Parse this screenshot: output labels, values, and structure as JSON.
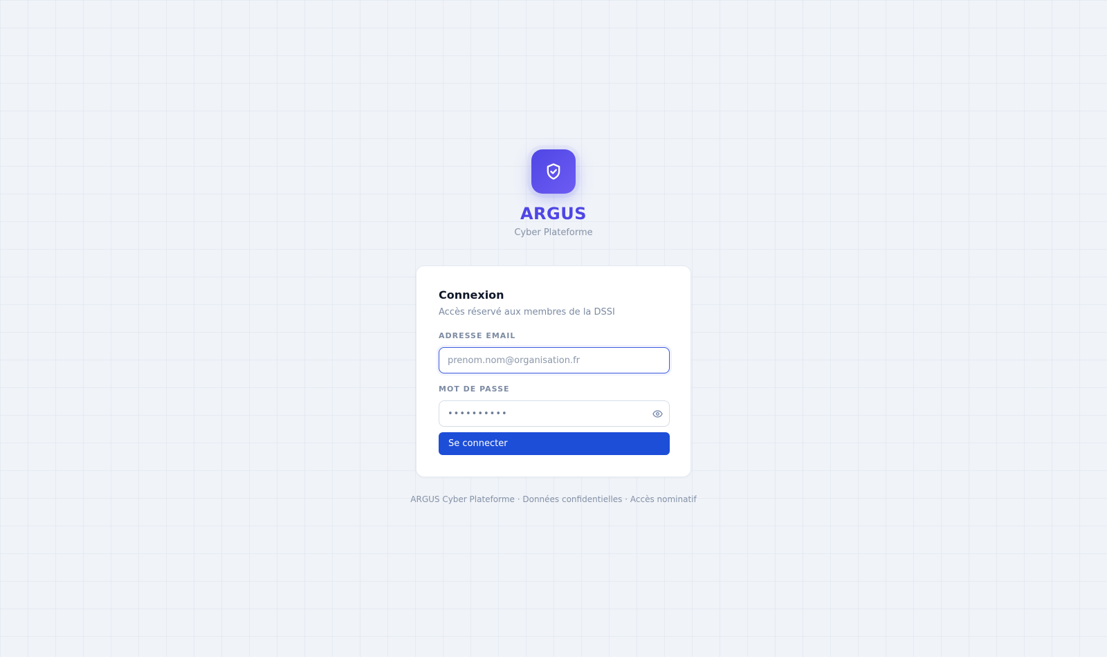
{
  "brand": {
    "name": "ARGUS",
    "tagline": "Cyber Plateforme",
    "logo_icon": "shield-check-icon",
    "accent_color": "#4f46e5"
  },
  "login": {
    "title": "Connexion",
    "subtitle": "Accès réservé aux membres de la DSSI",
    "email": {
      "label": "ADRESSE EMAIL",
      "placeholder": "prenom.nom@organisation.fr",
      "value": ""
    },
    "password": {
      "label": "MOT DE PASSE",
      "masked_value": "••••••••••",
      "toggle_icon": "eye-icon"
    },
    "submit_label": "Se connecter",
    "button_color": "#1d4ed8"
  },
  "footer": {
    "text": "ARGUS Cyber Plateforme · Données confidentielles · Accès nominatif"
  }
}
